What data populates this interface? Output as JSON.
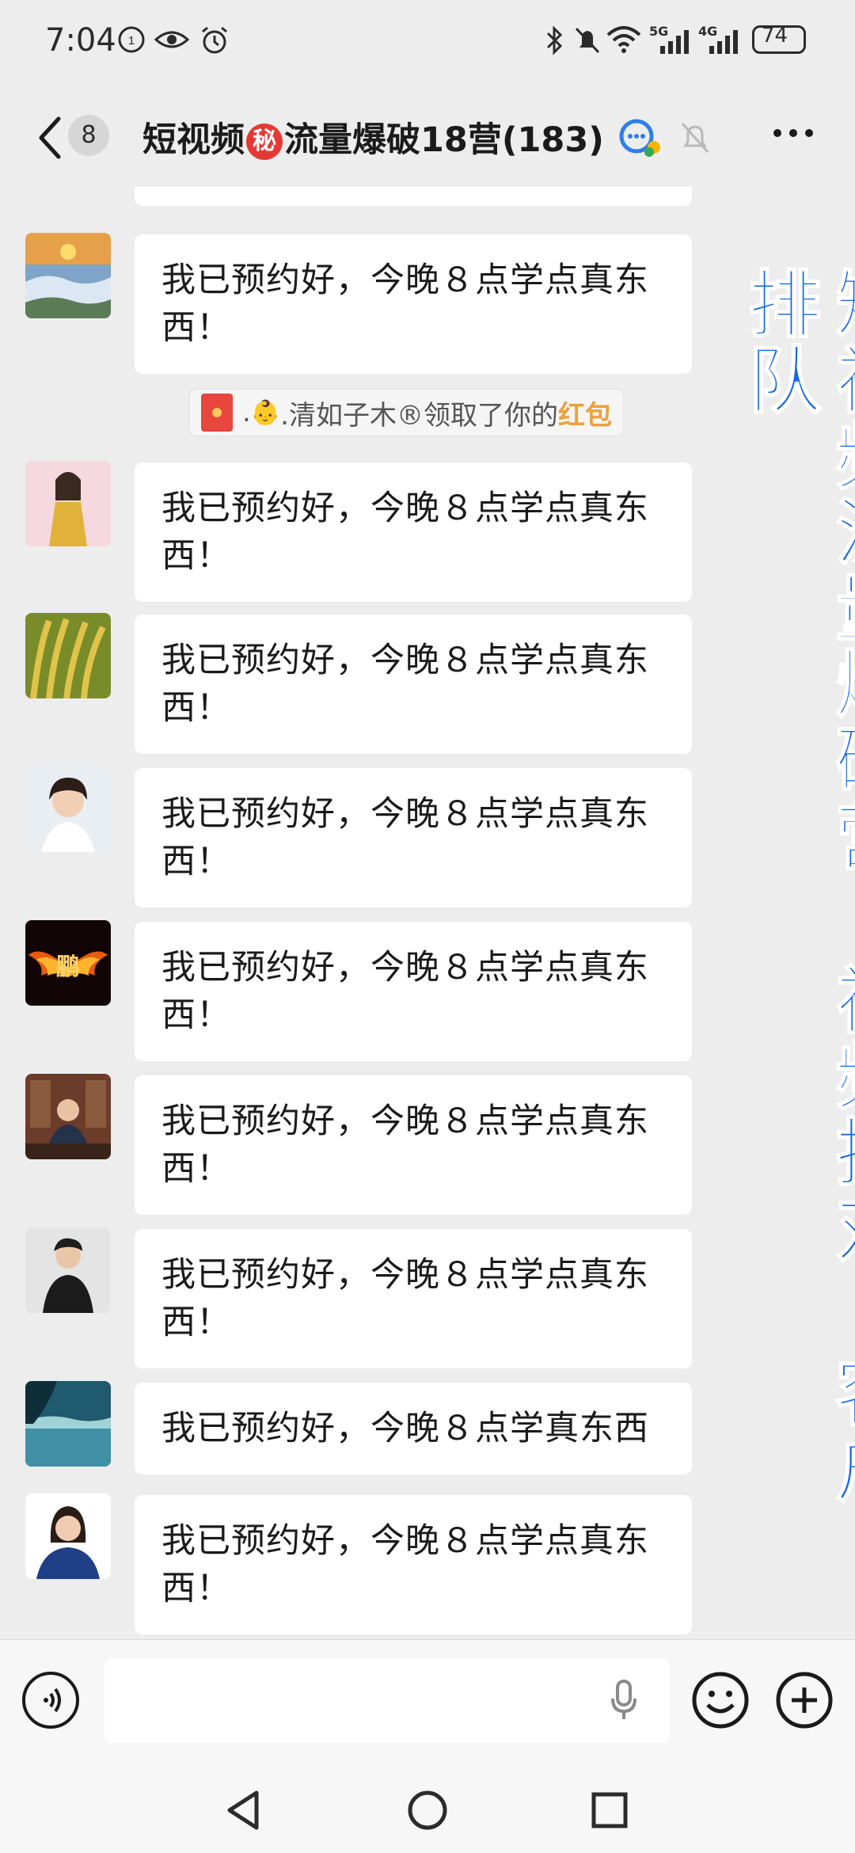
{
  "status_bar": {
    "time": "7:04",
    "battery": "74",
    "network_5g": "5G",
    "network_4g": "4G"
  },
  "header": {
    "unread_count": "8",
    "title_part1": "短视频",
    "secret_badge": "秘",
    "title_part2": "流量爆破18营(183)"
  },
  "messages": [
    {
      "text": "我已预约好，今晚８点学点真东西！",
      "avatar": "sunrise-mountain"
    },
    {
      "text": "我已预约好，今晚８点学点真东西！",
      "avatar": "woman-in-yellow"
    },
    {
      "text": "我已预约好，今晚８点学点真东西！",
      "avatar": "wheat-field"
    },
    {
      "text": "我已预约好，今晚８点学点真东西！",
      "avatar": "woman-portrait"
    },
    {
      "text": "我已预约好，今晚８点学点真东西！",
      "avatar": "fire-wings-peng",
      "avatar_text": "鹏"
    },
    {
      "text": "我已预约好，今晚８点学点真东西！",
      "avatar": "man-in-suit-office"
    },
    {
      "text": "我已预约好，今晚８点学点真东西！",
      "avatar": "man-thinking"
    },
    {
      "text": "我已预约好，今晚８点学真东西",
      "avatar": "misty-lake"
    },
    {
      "text": "我已预约好，今晚８点学点真东西！",
      "avatar": "woman-in-blue-suit"
    }
  ],
  "system_notice": {
    "prefix": ".",
    "emoji": "👶",
    "text": ".清如子木®领取了你的",
    "link": "红包"
  },
  "promo_overlay": "短视频流量爆破营·视频拍对 客户排队",
  "colors": {
    "background": "#ededed",
    "bubble": "#ffffff",
    "promo_blue": "#1367e6",
    "red_packet": "#e8453c",
    "red_packet_link": "#e9a23b"
  }
}
